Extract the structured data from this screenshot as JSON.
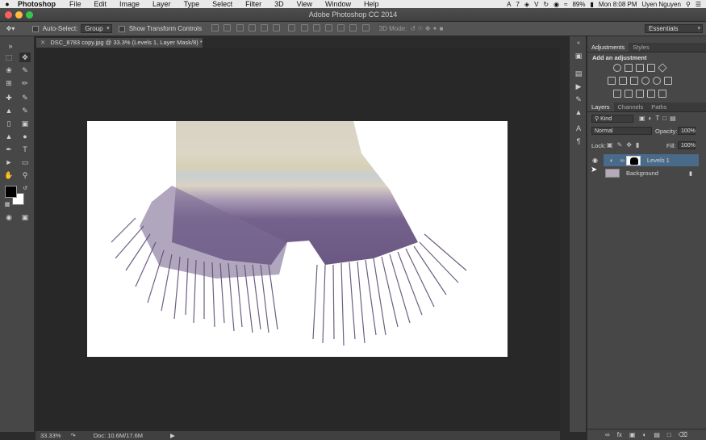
{
  "menubar": {
    "app_name": "Photoshop",
    "items": [
      "File",
      "Edit",
      "Image",
      "Layer",
      "Type",
      "Select",
      "Filter",
      "3D",
      "View",
      "Window",
      "Help"
    ],
    "status": {
      "battery": "89%",
      "clock": "Mon 8:08 PM",
      "user": "Uyen Nguyen",
      "badge": "7"
    }
  },
  "window": {
    "title": "Adobe Photoshop CC 2014"
  },
  "options": {
    "auto_select_label": "Auto-Select:",
    "auto_select_value": "Group",
    "show_transform_label": "Show Transform Controls",
    "mode_3d_label": "3D Mode:",
    "workspace": "Essentials"
  },
  "document": {
    "tab_title": "DSC_8783 copy.jpg @ 33.3% (Levels 1, Layer Mask/8) *"
  },
  "status": {
    "zoom": "33.33%",
    "doc_size": "Doc: 10.6M/17.6M"
  },
  "adjustments_panel": {
    "tabs": [
      "Adjustments",
      "Styles"
    ],
    "heading": "Add an adjustment"
  },
  "layers_panel": {
    "tabs": [
      "Layers",
      "Channels",
      "Paths"
    ],
    "filter_kind": "Kind",
    "blend_mode": "Normal",
    "opacity_label": "Opacity:",
    "opacity_value": "100%",
    "lock_label": "Lock:",
    "fill_label": "Fill:",
    "fill_value": "100%",
    "layers": [
      {
        "name": "Levels 1",
        "selected": true
      },
      {
        "name": "Background",
        "selected": false
      }
    ]
  },
  "colors": {
    "accent_selected_layer": "#4a6a8a",
    "fg": "#000000",
    "bg": "#ffffff"
  }
}
